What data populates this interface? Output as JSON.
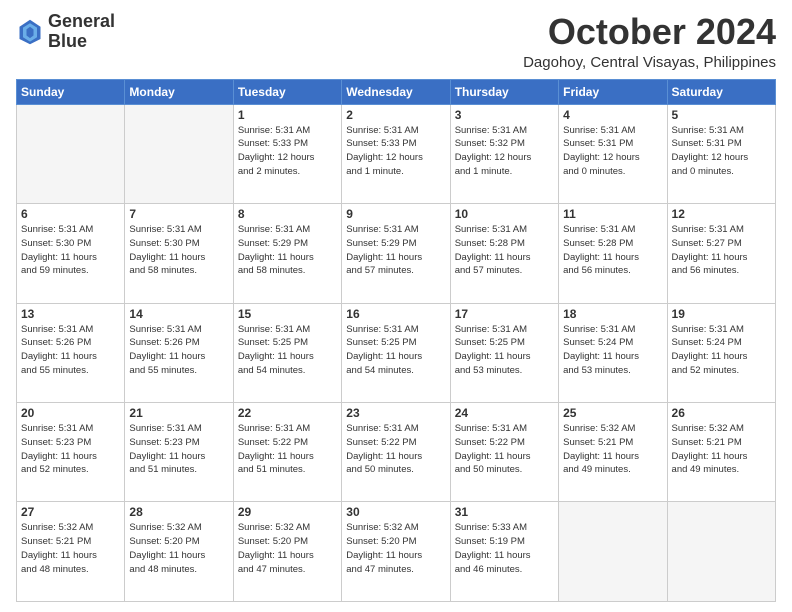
{
  "header": {
    "logo_line1": "General",
    "logo_line2": "Blue",
    "month": "October 2024",
    "location": "Dagohoy, Central Visayas, Philippines"
  },
  "days_of_week": [
    "Sunday",
    "Monday",
    "Tuesday",
    "Wednesday",
    "Thursday",
    "Friday",
    "Saturday"
  ],
  "weeks": [
    [
      {
        "day": "",
        "info": ""
      },
      {
        "day": "",
        "info": ""
      },
      {
        "day": "1",
        "info": "Sunrise: 5:31 AM\nSunset: 5:33 PM\nDaylight: 12 hours\nand 2 minutes."
      },
      {
        "day": "2",
        "info": "Sunrise: 5:31 AM\nSunset: 5:33 PM\nDaylight: 12 hours\nand 1 minute."
      },
      {
        "day": "3",
        "info": "Sunrise: 5:31 AM\nSunset: 5:32 PM\nDaylight: 12 hours\nand 1 minute."
      },
      {
        "day": "4",
        "info": "Sunrise: 5:31 AM\nSunset: 5:31 PM\nDaylight: 12 hours\nand 0 minutes."
      },
      {
        "day": "5",
        "info": "Sunrise: 5:31 AM\nSunset: 5:31 PM\nDaylight: 12 hours\nand 0 minutes."
      }
    ],
    [
      {
        "day": "6",
        "info": "Sunrise: 5:31 AM\nSunset: 5:30 PM\nDaylight: 11 hours\nand 59 minutes."
      },
      {
        "day": "7",
        "info": "Sunrise: 5:31 AM\nSunset: 5:30 PM\nDaylight: 11 hours\nand 58 minutes."
      },
      {
        "day": "8",
        "info": "Sunrise: 5:31 AM\nSunset: 5:29 PM\nDaylight: 11 hours\nand 58 minutes."
      },
      {
        "day": "9",
        "info": "Sunrise: 5:31 AM\nSunset: 5:29 PM\nDaylight: 11 hours\nand 57 minutes."
      },
      {
        "day": "10",
        "info": "Sunrise: 5:31 AM\nSunset: 5:28 PM\nDaylight: 11 hours\nand 57 minutes."
      },
      {
        "day": "11",
        "info": "Sunrise: 5:31 AM\nSunset: 5:28 PM\nDaylight: 11 hours\nand 56 minutes."
      },
      {
        "day": "12",
        "info": "Sunrise: 5:31 AM\nSunset: 5:27 PM\nDaylight: 11 hours\nand 56 minutes."
      }
    ],
    [
      {
        "day": "13",
        "info": "Sunrise: 5:31 AM\nSunset: 5:26 PM\nDaylight: 11 hours\nand 55 minutes."
      },
      {
        "day": "14",
        "info": "Sunrise: 5:31 AM\nSunset: 5:26 PM\nDaylight: 11 hours\nand 55 minutes."
      },
      {
        "day": "15",
        "info": "Sunrise: 5:31 AM\nSunset: 5:25 PM\nDaylight: 11 hours\nand 54 minutes."
      },
      {
        "day": "16",
        "info": "Sunrise: 5:31 AM\nSunset: 5:25 PM\nDaylight: 11 hours\nand 54 minutes."
      },
      {
        "day": "17",
        "info": "Sunrise: 5:31 AM\nSunset: 5:25 PM\nDaylight: 11 hours\nand 53 minutes."
      },
      {
        "day": "18",
        "info": "Sunrise: 5:31 AM\nSunset: 5:24 PM\nDaylight: 11 hours\nand 53 minutes."
      },
      {
        "day": "19",
        "info": "Sunrise: 5:31 AM\nSunset: 5:24 PM\nDaylight: 11 hours\nand 52 minutes."
      }
    ],
    [
      {
        "day": "20",
        "info": "Sunrise: 5:31 AM\nSunset: 5:23 PM\nDaylight: 11 hours\nand 52 minutes."
      },
      {
        "day": "21",
        "info": "Sunrise: 5:31 AM\nSunset: 5:23 PM\nDaylight: 11 hours\nand 51 minutes."
      },
      {
        "day": "22",
        "info": "Sunrise: 5:31 AM\nSunset: 5:22 PM\nDaylight: 11 hours\nand 51 minutes."
      },
      {
        "day": "23",
        "info": "Sunrise: 5:31 AM\nSunset: 5:22 PM\nDaylight: 11 hours\nand 50 minutes."
      },
      {
        "day": "24",
        "info": "Sunrise: 5:31 AM\nSunset: 5:22 PM\nDaylight: 11 hours\nand 50 minutes."
      },
      {
        "day": "25",
        "info": "Sunrise: 5:32 AM\nSunset: 5:21 PM\nDaylight: 11 hours\nand 49 minutes."
      },
      {
        "day": "26",
        "info": "Sunrise: 5:32 AM\nSunset: 5:21 PM\nDaylight: 11 hours\nand 49 minutes."
      }
    ],
    [
      {
        "day": "27",
        "info": "Sunrise: 5:32 AM\nSunset: 5:21 PM\nDaylight: 11 hours\nand 48 minutes."
      },
      {
        "day": "28",
        "info": "Sunrise: 5:32 AM\nSunset: 5:20 PM\nDaylight: 11 hours\nand 48 minutes."
      },
      {
        "day": "29",
        "info": "Sunrise: 5:32 AM\nSunset: 5:20 PM\nDaylight: 11 hours\nand 47 minutes."
      },
      {
        "day": "30",
        "info": "Sunrise: 5:32 AM\nSunset: 5:20 PM\nDaylight: 11 hours\nand 47 minutes."
      },
      {
        "day": "31",
        "info": "Sunrise: 5:33 AM\nSunset: 5:19 PM\nDaylight: 11 hours\nand 46 minutes."
      },
      {
        "day": "",
        "info": ""
      },
      {
        "day": "",
        "info": ""
      }
    ]
  ]
}
